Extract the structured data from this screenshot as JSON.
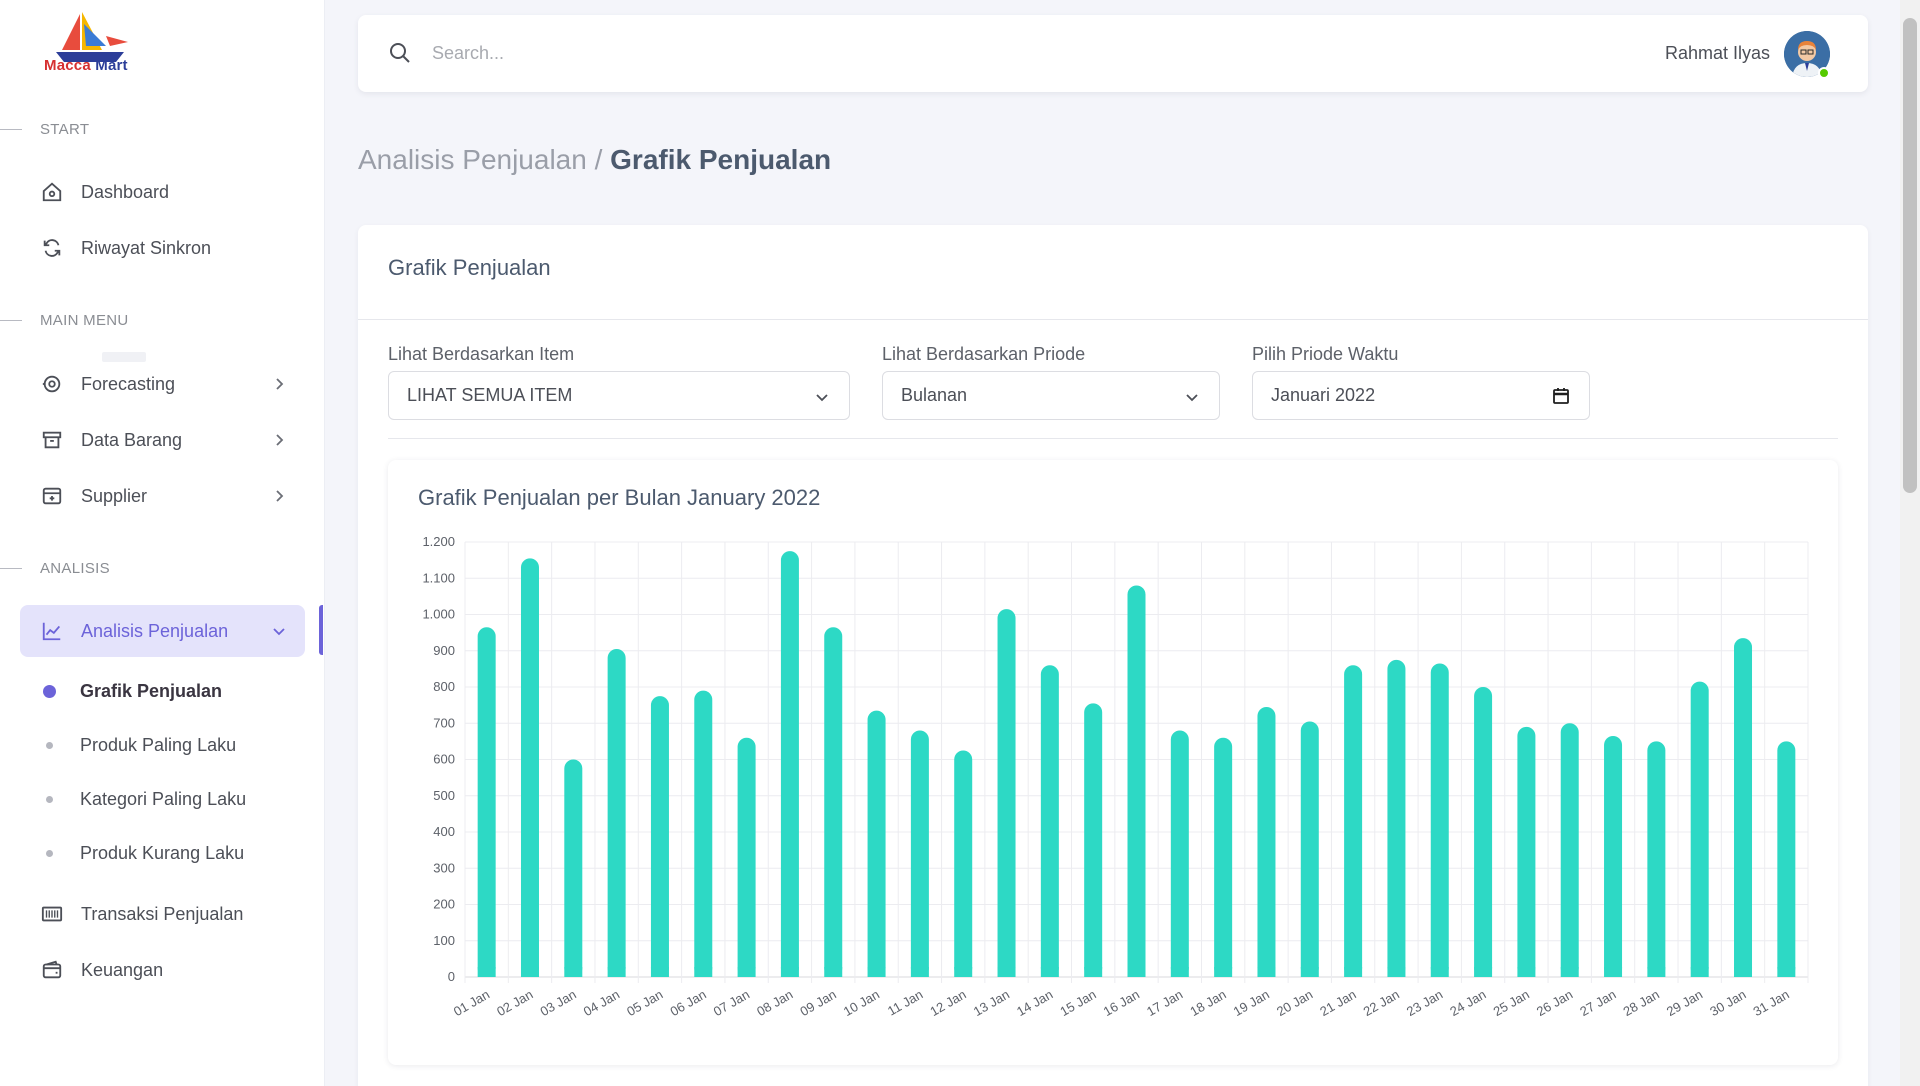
{
  "brand": {
    "name_part1": "Macca",
    "name_part2": "Mart"
  },
  "sidebar": {
    "sections": {
      "start": "START",
      "main": "MAIN MENU",
      "analisis": "ANALISIS"
    },
    "items": {
      "dashboard": "Dashboard",
      "riwayat": "Riwayat Sinkron",
      "forecasting": "Forecasting",
      "data_barang": "Data Barang",
      "supplier": "Supplier",
      "analisis_penjualan": "Analisis Penjualan",
      "grafik": "Grafik Penjualan",
      "produk_laku": "Produk Paling Laku",
      "kategori_laku": "Kategori Paling Laku",
      "produk_kurang": "Produk Kurang Laku",
      "transaksi": "Transaksi Penjualan",
      "keuangan": "Keuangan"
    }
  },
  "topbar": {
    "search_placeholder": "Search...",
    "user_name": "Rahmat Ilyas"
  },
  "breadcrumb": {
    "parent": "Analisis Penjualan",
    "separator": " / ",
    "current": "Grafik Penjualan"
  },
  "card": {
    "title": "Grafik Penjualan",
    "filters": {
      "item_label": "Lihat Berdasarkan Item",
      "item_value": "LIHAT SEMUA ITEM",
      "periode_label": "Lihat Berdasarkan Priode",
      "periode_value": "Bulanan",
      "waktu_label": "Pilih Priode Waktu",
      "waktu_value": "Januari 2022"
    }
  },
  "colors": {
    "accent": "#6c63d9",
    "bar": "#2dd9c5"
  },
  "chart_data": {
    "type": "bar",
    "title": "Grafik Penjualan per Bulan January 2022",
    "categories": [
      "01 Jan",
      "02 Jan",
      "03 Jan",
      "04 Jan",
      "05 Jan",
      "06 Jan",
      "07 Jan",
      "08 Jan",
      "09 Jan",
      "10 Jan",
      "11 Jan",
      "12 Jan",
      "13 Jan",
      "14 Jan",
      "15 Jan",
      "16 Jan",
      "17 Jan",
      "18 Jan",
      "19 Jan",
      "20 Jan",
      "21 Jan",
      "22 Jan",
      "23 Jan",
      "24 Jan",
      "25 Jan",
      "26 Jan",
      "27 Jan",
      "28 Jan",
      "29 Jan",
      "30 Jan",
      "31 Jan"
    ],
    "values": [
      965,
      1155,
      600,
      905,
      775,
      790,
      660,
      1175,
      965,
      735,
      680,
      625,
      1015,
      860,
      755,
      1080,
      680,
      660,
      745,
      705,
      860,
      875,
      865,
      800,
      690,
      700,
      665,
      650,
      815,
      935,
      650
    ],
    "yticks": [
      "0",
      "100",
      "200",
      "300",
      "400",
      "500",
      "600",
      "700",
      "800",
      "900",
      "1.000",
      "1.100",
      "1.200"
    ],
    "ylim": [
      0,
      1200
    ],
    "grid": true
  }
}
